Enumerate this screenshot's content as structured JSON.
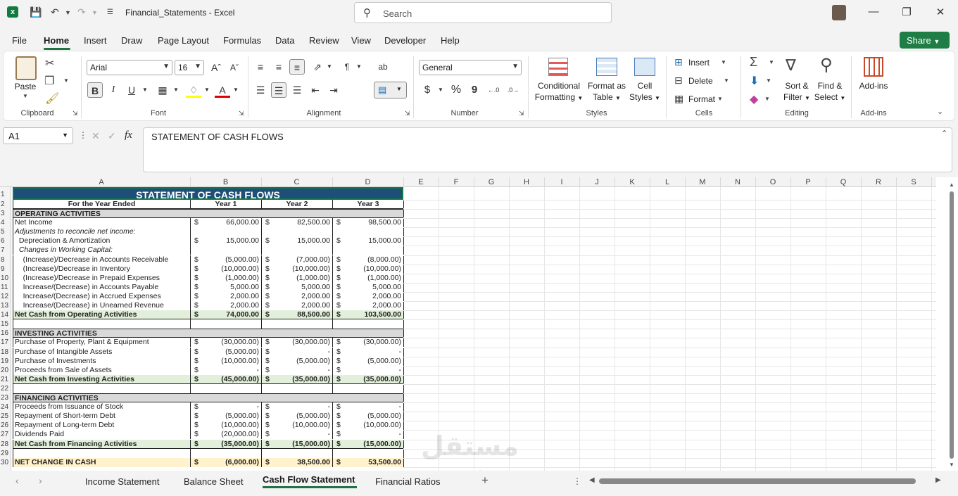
{
  "title_bar": {
    "doc_name": "Financial_Statements",
    "separator": " - ",
    "app_name": "Excel",
    "search_placeholder": "Search"
  },
  "menu": [
    "File",
    "Home",
    "Insert",
    "Draw",
    "Page Layout",
    "Formulas",
    "Data",
    "Review",
    "View",
    "Developer",
    "Help"
  ],
  "share_label": "Share",
  "ribbon": {
    "clipboard": {
      "label": "Clipboard",
      "paste": "Paste"
    },
    "font": {
      "label": "Font",
      "name": "Arial",
      "size": "16"
    },
    "alignment": {
      "label": "Alignment"
    },
    "number": {
      "label": "Number",
      "format": "General",
      "currency": "$",
      "percent": "%",
      "comma": "9"
    },
    "styles": {
      "label": "Styles",
      "conditional_1": "Conditional",
      "conditional_2": "Formatting",
      "format_table_1": "Format as",
      "format_table_2": "Table",
      "cell_styles_1": "Cell",
      "cell_styles_2": "Styles"
    },
    "cells": {
      "label": "Cells",
      "insert": "Insert",
      "delete": "Delete",
      "format": "Format"
    },
    "editing": {
      "label": "Editing",
      "sort_1": "Sort &",
      "sort_2": "Filter",
      "find_1": "Find &",
      "find_2": "Select"
    },
    "addins": {
      "label": "Add-ins",
      "button": "Add-ins"
    }
  },
  "formula_bar": {
    "name_box": "A1",
    "fx": "fx",
    "content": "STATEMENT OF CASH FLOWS"
  },
  "columns": [
    "A",
    "B",
    "C",
    "D",
    "E",
    "F",
    "G",
    "H",
    "I",
    "J",
    "K",
    "L",
    "M",
    "N",
    "O",
    "P",
    "Q",
    "R",
    "S"
  ],
  "sheet": {
    "title": "STATEMENT OF CASH FLOWS",
    "header": {
      "label": "For the Year Ended",
      "y1": "Year 1",
      "y2": "Year 2",
      "y3": "Year 3"
    },
    "rows": [
      {
        "n": "3",
        "label": "OPERATING ACTIVITIES",
        "style": "section"
      },
      {
        "n": "4",
        "label": "Net Income",
        "v": [
          "66,000.00",
          "82,500.00",
          "98,500.00"
        ]
      },
      {
        "n": "5",
        "label": "Adjustments to reconcile net income:",
        "style": "italic"
      },
      {
        "n": "6",
        "label": "  Depreciation & Amortization",
        "v": [
          "15,000.00",
          "15,000.00",
          "15,000.00"
        ]
      },
      {
        "n": "7",
        "label": "  Changes in Working Capital:",
        "style": "italic"
      },
      {
        "n": "8",
        "label": "    (Increase)/Decrease in Accounts Receivable",
        "v": [
          "(5,000.00)",
          "(7,000.00)",
          "(8,000.00)"
        ]
      },
      {
        "n": "9",
        "label": "    (Increase)/Decrease in Inventory",
        "v": [
          "(10,000.00)",
          "(10,000.00)",
          "(10,000.00)"
        ]
      },
      {
        "n": "10",
        "label": "    (Increase)/Decrease in Prepaid Expenses",
        "v": [
          "(1,000.00)",
          "(1,000.00)",
          "(1,000.00)"
        ]
      },
      {
        "n": "11",
        "label": "    Increase/(Decrease) in Accounts Payable",
        "v": [
          "5,000.00",
          "5,000.00",
          "5,000.00"
        ]
      },
      {
        "n": "12",
        "label": "    Increase/(Decrease) in Accrued Expenses",
        "v": [
          "2,000.00",
          "2,000.00",
          "2,000.00"
        ]
      },
      {
        "n": "13",
        "label": "    Increase/(Decrease) in Unearned Revenue",
        "v": [
          "2,000.00",
          "2,000.00",
          "2,000.00"
        ]
      },
      {
        "n": "14",
        "label": "Net Cash from Operating Activities",
        "v": [
          "74,000.00",
          "88,500.00",
          "103,500.00"
        ],
        "style": "total"
      },
      {
        "n": "15",
        "label": "",
        "style": "blank"
      },
      {
        "n": "16",
        "label": "INVESTING ACTIVITIES",
        "style": "section"
      },
      {
        "n": "17",
        "label": "Purchase of Property, Plant & Equipment",
        "v": [
          "(30,000.00)",
          "(30,000.00)",
          "(30,000.00)"
        ]
      },
      {
        "n": "18",
        "label": "Purchase of Intangible Assets",
        "v": [
          "(5,000.00)",
          "-",
          "-"
        ]
      },
      {
        "n": "19",
        "label": "Purchase of Investments",
        "v": [
          "(10,000.00)",
          "(5,000.00)",
          "(5,000.00)"
        ]
      },
      {
        "n": "20",
        "label": "Proceeds from Sale of Assets",
        "v": [
          "-",
          "-",
          "-"
        ]
      },
      {
        "n": "21",
        "label": "Net Cash from Investing Activities",
        "v": [
          "(45,000.00)",
          "(35,000.00)",
          "(35,000.00)"
        ],
        "style": "total"
      },
      {
        "n": "22",
        "label": "",
        "style": "blank"
      },
      {
        "n": "23",
        "label": "FINANCING ACTIVITIES",
        "style": "section"
      },
      {
        "n": "24",
        "label": "Proceeds from Issuance of Stock",
        "v": [
          "-",
          "-",
          "-"
        ]
      },
      {
        "n": "25",
        "label": "Repayment of Short-term Debt",
        "v": [
          "(5,000.00)",
          "(5,000.00)",
          "(5,000.00)"
        ]
      },
      {
        "n": "26",
        "label": "Repayment of Long-term Debt",
        "v": [
          "(10,000.00)",
          "(10,000.00)",
          "(10,000.00)"
        ]
      },
      {
        "n": "27",
        "label": "Dividends Paid",
        "v": [
          "(20,000.00)",
          "-",
          "-"
        ]
      },
      {
        "n": "28",
        "label": "Net Cash from Financing Activities",
        "v": [
          "(35,000.00)",
          "(15,000.00)",
          "(15,000.00)"
        ],
        "style": "total"
      },
      {
        "n": "29",
        "label": "",
        "style": "blank"
      },
      {
        "n": "30",
        "label": "NET CHANGE IN CASH",
        "v": [
          "(6,000.00)",
          "38,500.00",
          "53,500.00"
        ],
        "style": "net"
      }
    ]
  },
  "tabs": [
    "Income Statement",
    "Balance Sheet",
    "Cash Flow Statement",
    "Financial Ratios"
  ],
  "active_tab": "Cash Flow Statement",
  "watermark": {
    "line1": "مستقل",
    "line2": "mostaql.com"
  },
  "colors": {
    "title_fill": "#1f4e78",
    "section_fill": "#d9d9d9",
    "total_fill": "#e2efda",
    "net_fill": "#fff2cc",
    "accent": "#217346"
  }
}
